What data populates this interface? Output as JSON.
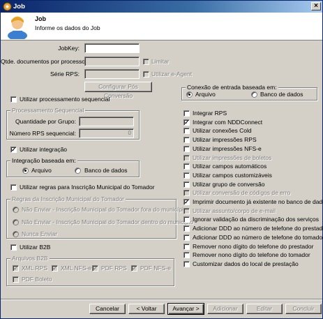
{
  "window": {
    "title": "Job",
    "close_label": "×"
  },
  "header": {
    "title": "Job",
    "subtitle": "Informe os dados do Job"
  },
  "form": {
    "jobkey_label": "JobKey:",
    "jobkey_value": "",
    "qtde_label": "Qtde. documentos por processo:",
    "limitar_label": "Limitar",
    "serie_label": "Série RPS:",
    "utilizar_eagent_label": "Utilizar e-Agent",
    "configurar_pos_conversao": "Configurar Pós Conversão"
  },
  "conexao": {
    "title": "Conexão de entrada baseada em:",
    "arquivo": "Arquivo",
    "banco": "Banco de dados"
  },
  "processamento": {
    "utilizar_label": "Utilizar processamento sequencial",
    "group_title": "Processamento Sequencial",
    "quantidade_label": "Quantidade por Grupo:",
    "numero_label": "Número RPS sequencial:",
    "numero_value": "0"
  },
  "integracao": {
    "utilizar_label": "Utilizar integração",
    "group_title": "Integração baseada em:",
    "arquivo": "Arquivo",
    "banco": "Banco de dados"
  },
  "inscricao": {
    "utilizar_label": "Utilizar regras para Inscrição Municipal do Tomador",
    "group_title": "Regras da Inscrição Municipal do Tomador",
    "options": [
      "Não Enviar - Inscrição Municipal do Tomador fora do município",
      "Não Enviar - Inscrição Municipal do Tomador dentro do município",
      "Nunca Enviar"
    ]
  },
  "b2b": {
    "utilizar_label": "Utilizar B2B",
    "group_title": "Arquivos B2B",
    "items": [
      "XML RPS",
      "XML NFS-e",
      "PDF RPS",
      "PDF NFS-e",
      "PDF Boleto"
    ]
  },
  "right_options": [
    {
      "label": "Integrar RPS",
      "checked": false,
      "enabled": true
    },
    {
      "label": "Integrar com NDDConnect",
      "checked": true,
      "enabled": true
    },
    {
      "label": "Utilizar conexões Cold",
      "checked": false,
      "enabled": true
    },
    {
      "label": "Utilizar impressões RPS",
      "checked": false,
      "enabled": true
    },
    {
      "label": "Utilizar impressões NFS-e",
      "checked": false,
      "enabled": true
    },
    {
      "label": "Utilizar impressões de boletos",
      "checked": false,
      "enabled": false
    },
    {
      "label": "Utilizar campos automáticos",
      "checked": false,
      "enabled": true
    },
    {
      "label": "Utilizar campos customizáveis",
      "checked": false,
      "enabled": true
    },
    {
      "label": "Utilizar grupo de conversão",
      "checked": false,
      "enabled": true
    },
    {
      "label": "Utilizar conversão de códigos de erro",
      "checked": false,
      "enabled": false
    },
    {
      "label": "Imprimir documento já existente no banco de dados",
      "checked": true,
      "enabled": true
    },
    {
      "label": "Utilizar assunto/corpo de e-mail",
      "checked": false,
      "enabled": false
    },
    {
      "label": "Ignorar validação da discriminação dos serviços",
      "checked": false,
      "enabled": true
    },
    {
      "label": "Adicionar DDD ao número de telefone do prestador",
      "checked": false,
      "enabled": true
    },
    {
      "label": "Adicionar DDD ao número de telefone do tomador",
      "checked": false,
      "enabled": true
    },
    {
      "label": "Remover nono dígito do telefone do prestador",
      "checked": false,
      "enabled": true
    },
    {
      "label": "Remover nono dígito do telefone do tomador",
      "checked": false,
      "enabled": true
    },
    {
      "label": "Customizar dados do local de prestação",
      "checked": false,
      "enabled": true
    }
  ],
  "footer": {
    "cancelar": "Cancelar",
    "voltar": "< Voltar",
    "avancar": "Avançar >",
    "adicionar": "Adicionar",
    "editar": "Editar",
    "concluir": "Concluir"
  },
  "colors": {
    "title_bar": "#0a246a",
    "face": "#d4d0c8",
    "disabled_text": "#808080"
  }
}
